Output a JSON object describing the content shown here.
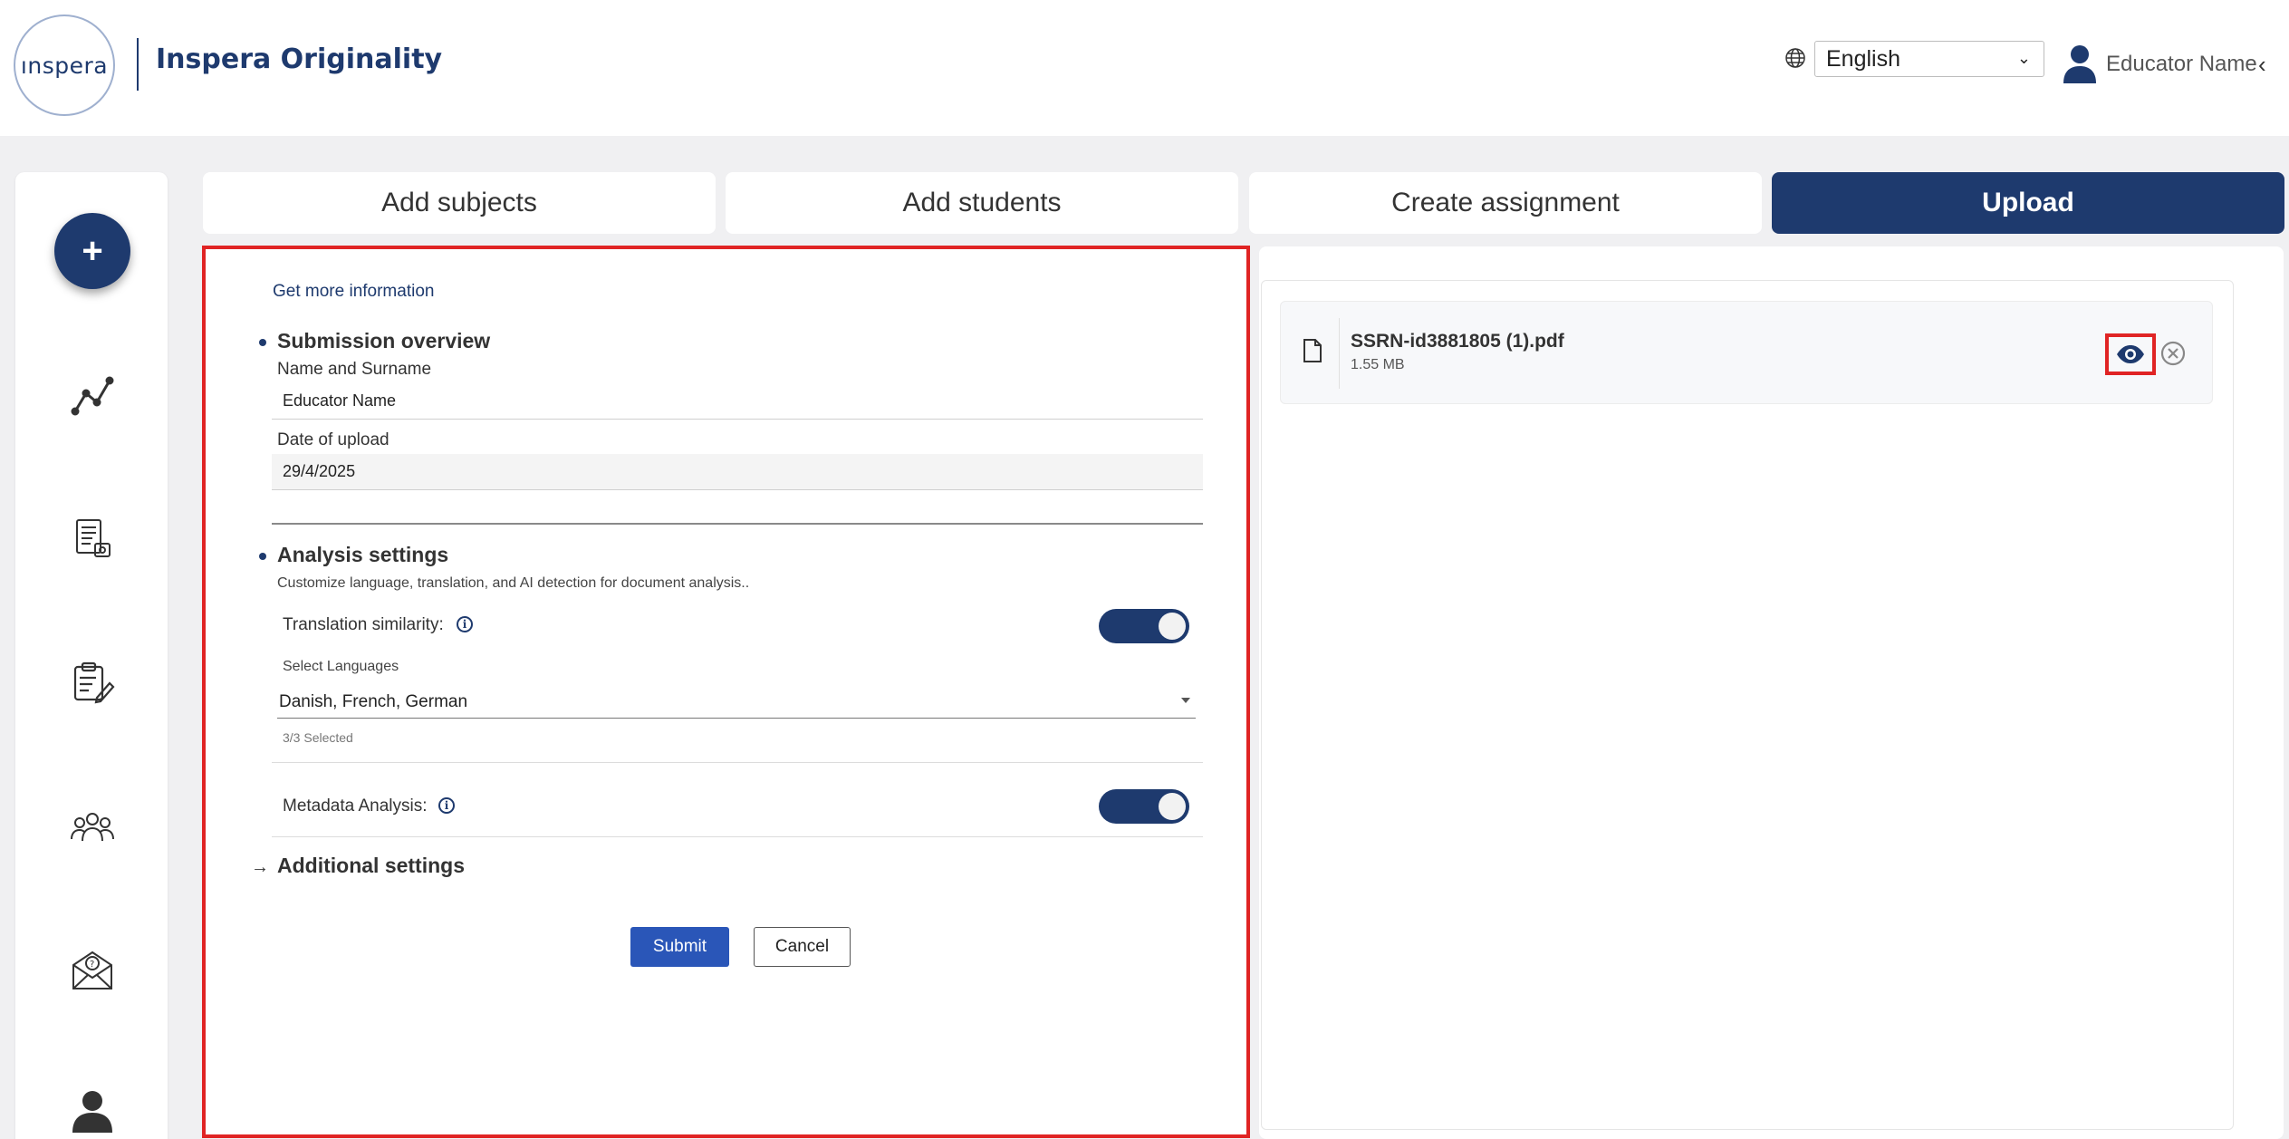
{
  "header": {
    "logo_text": "ınspera",
    "app_title": "Inspera Originality",
    "language": "English",
    "user_name": "Educator Name"
  },
  "steps": [
    {
      "label": "Add subjects",
      "active": false
    },
    {
      "label": "Add students",
      "active": false
    },
    {
      "label": "Create assignment",
      "active": false
    },
    {
      "label": "Upload",
      "active": true
    }
  ],
  "sidebar": {
    "fab_label": "+",
    "icons": [
      "analytics-icon",
      "document-report-icon",
      "clipboard-edit-icon",
      "group-icon",
      "mail-help-icon",
      "user-profile-icon"
    ]
  },
  "form": {
    "more_info_link": "Get more information",
    "submission_overview": {
      "title": "Submission overview",
      "name_label": "Name and Surname",
      "name_value": "Educator Name",
      "date_label": "Date of upload",
      "date_value": "29/4/2025"
    },
    "analysis_settings": {
      "title": "Analysis settings",
      "description": "Customize language, translation, and AI detection for document analysis..",
      "translation_label": "Translation similarity:",
      "translation_enabled": true,
      "languages_label": "Select Languages",
      "languages_value": "Danish, French, German",
      "languages_count": "3/3 Selected",
      "metadata_label": "Metadata Analysis:",
      "metadata_enabled": true
    },
    "additional_settings": "Additional settings",
    "submit_label": "Submit",
    "cancel_label": "Cancel"
  },
  "file": {
    "name": "SSRN-id3881805 (1).pdf",
    "size": "1.55 MB"
  },
  "colors": {
    "brand": "#1e3a6e",
    "submit": "#2a56b8",
    "highlight": "#e02424"
  }
}
